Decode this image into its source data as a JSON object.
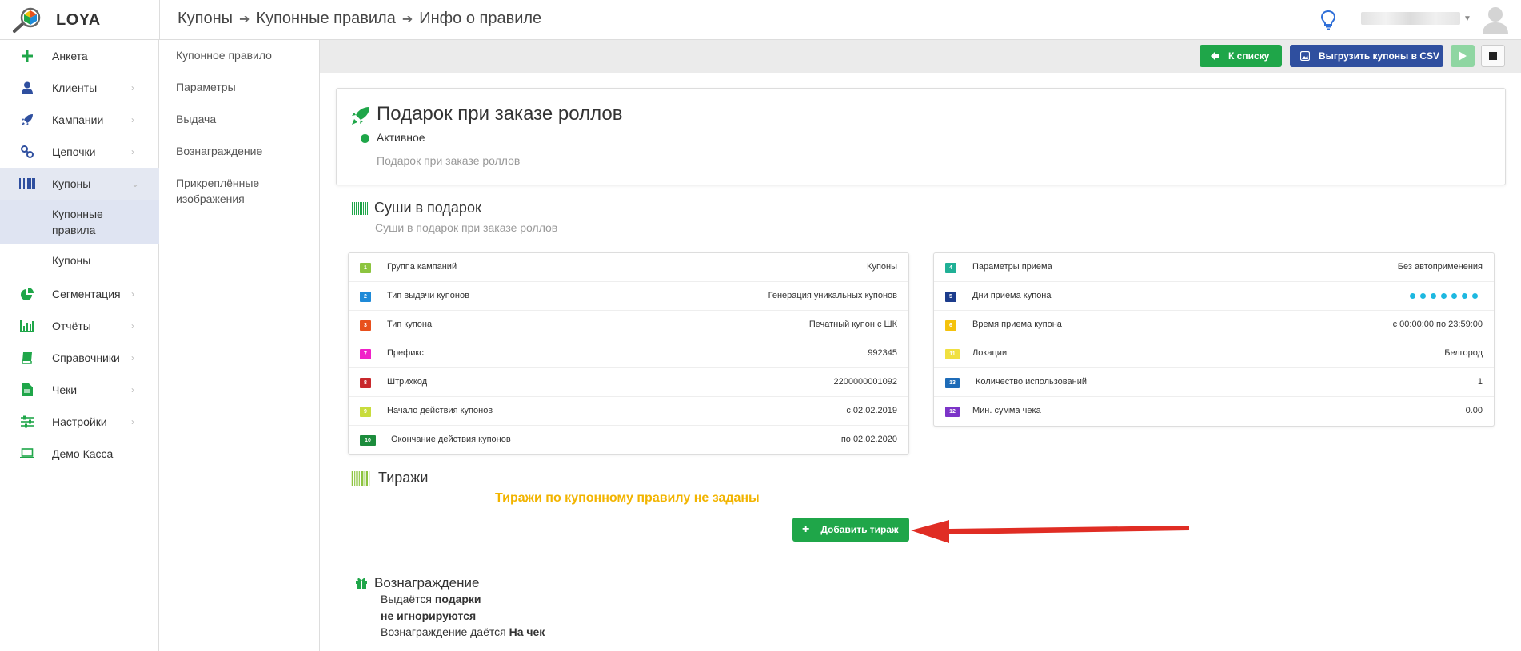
{
  "app": {
    "name": "LOYA"
  },
  "breadcrumb": [
    "Купоны",
    "Купонные правила",
    "Инфо о правиле"
  ],
  "sidebar": {
    "items": [
      {
        "label": "Анкета",
        "icon": "plus-icon"
      },
      {
        "label": "Клиенты",
        "icon": "user-icon"
      },
      {
        "label": "Кампании",
        "icon": "rocket-icon"
      },
      {
        "label": "Цепочки",
        "icon": "chain-icon"
      },
      {
        "label": "Купоны",
        "icon": "barcode-icon"
      },
      {
        "label": "Сегментация",
        "icon": "pie-chart-icon"
      },
      {
        "label": "Отчёты",
        "icon": "bar-chart-icon"
      },
      {
        "label": "Справочники",
        "icon": "book-icon"
      },
      {
        "label": "Чеки",
        "icon": "receipt-icon"
      },
      {
        "label": "Настройки",
        "icon": "sliders-icon"
      },
      {
        "label": "Демо Касса",
        "icon": "laptop-icon"
      }
    ],
    "sub_items": [
      "Купонные правила",
      "Купоны"
    ]
  },
  "submenu": {
    "items": [
      "Купонное правило",
      "Параметры",
      "Выдача",
      "Вознаграждение",
      "Прикреплённые изображения"
    ]
  },
  "toolbar": {
    "back_label": "К списку",
    "export_label": "Выгрузить купоны в CSV"
  },
  "rule": {
    "title": "Подарок при заказе роллов",
    "status": "Активное",
    "description": "Подарок при заказе роллов"
  },
  "campaign": {
    "title": "Суши в подарок",
    "subtitle": "Суши в подарок при заказе роллов"
  },
  "params_left": [
    {
      "num": "1",
      "color": "#8cc43f",
      "name": "Группа кампаний",
      "value": "Купоны"
    },
    {
      "num": "2",
      "color": "#1e8ad8",
      "name": "Тип выдачи купонов",
      "value": "Генерация уникальных купонов"
    },
    {
      "num": "3",
      "color": "#e8501c",
      "name": "Тип купона",
      "value": "Печатный купон с ШК"
    },
    {
      "num": "7",
      "color": "#f020c8",
      "name": "Префикс",
      "value": "992345"
    },
    {
      "num": "8",
      "color": "#c8282c",
      "name": "Штрихкод",
      "value": "2200000001092"
    },
    {
      "num": "9",
      "color": "#c8dc3c",
      "name": "Начало действия купонов",
      "value": "с 02.02.2019"
    },
    {
      "num": "10",
      "color": "#1c8c3c",
      "name": "Окончание действия купонов",
      "value": "по 02.02.2020"
    }
  ],
  "params_right": [
    {
      "num": "4",
      "color": "#20b096",
      "name": "Параметры приема",
      "value": "Без автоприменения"
    },
    {
      "num": "5",
      "color": "#1c3c8c",
      "name": "Дни приема купона",
      "value": "",
      "dots": 7
    },
    {
      "num": "6",
      "color": "#f4c20c",
      "name": "Время приема купона",
      "value": "с 00:00:00 по 23:59:00"
    },
    {
      "num": "11",
      "color": "#f0e040",
      "name": "Локации",
      "value": "Белгород"
    },
    {
      "num": "13",
      "color": "#1e6cb8",
      "name": "Количество использований",
      "value": "1"
    },
    {
      "num": "12",
      "color": "#7c34c8",
      "name": "Мин. сумма чека",
      "value": "0.00"
    }
  ],
  "circulations": {
    "title": "Тиражи",
    "empty_message": "Тиражи по купонному правилу не заданы",
    "add_label": "Добавить тираж"
  },
  "reward": {
    "title": "Вознаграждение",
    "line1_prefix": "Выдаётся ",
    "line1_bold": "подарки",
    "line2_bold": "не игнорируются",
    "line3_prefix": "Вознаграждение даётся ",
    "line3_bold": "На чек"
  },
  "colors": {
    "green": "#1fa649",
    "blue": "#2f4f9f",
    "warning": "#f2b400",
    "dot": "#1db8e0",
    "arrow": "#e02d24"
  }
}
